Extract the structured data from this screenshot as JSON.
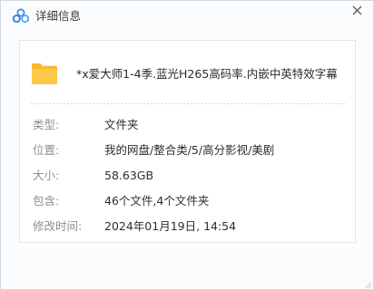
{
  "window": {
    "title": "详细信息",
    "icon": "cloud-logo-icon",
    "close_icon": "close-icon",
    "accent_color": "#3d8bf2"
  },
  "file": {
    "icon": "folder-icon",
    "icon_color": "#fbc23f",
    "name": "*x爱大师1-4季.蓝光H265高码率.内嵌中英特效字幕"
  },
  "details": [
    {
      "label": "类型:",
      "value": "文件夹"
    },
    {
      "label": "位置:",
      "value": "我的网盘/整合类/5/高分影视/美剧"
    },
    {
      "label": "大小:",
      "value": "58.63GB"
    },
    {
      "label": "包含:",
      "value": "46个文件,4个文件夹"
    },
    {
      "label": "修改时间:",
      "value": "2024年01月19日, 14:54"
    }
  ]
}
